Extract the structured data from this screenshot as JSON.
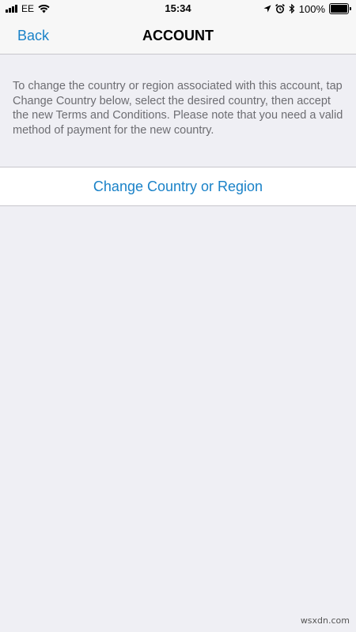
{
  "status_bar": {
    "carrier": "EE",
    "time": "15:34",
    "battery_percent": "100%",
    "battery_level": 1.0,
    "icons": [
      "signal-icon",
      "wifi-icon",
      "location-icon",
      "alarm-icon",
      "bluetooth-icon",
      "battery-icon"
    ]
  },
  "nav": {
    "back_label": "Back",
    "title": "ACCOUNT"
  },
  "main": {
    "description": "To change the country or region associated with this account, tap Change Country below, select the desired country, then accept the new Terms and Conditions. Please note that you need a valid method of payment for the new country.",
    "change_country_label": "Change Country or Region"
  },
  "watermark": "wsxdn.com",
  "colors": {
    "accent": "#1a82c8",
    "background": "#efeff4",
    "secondary_text": "#6d6d72"
  }
}
